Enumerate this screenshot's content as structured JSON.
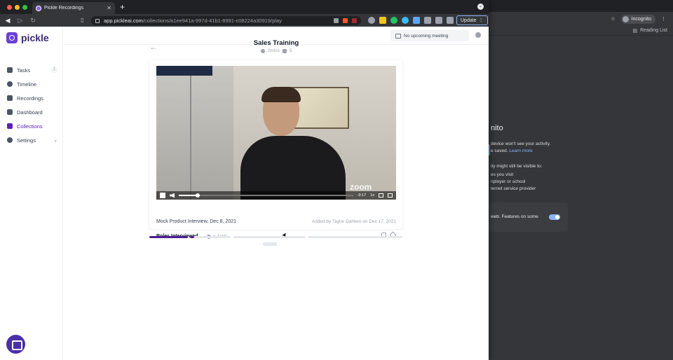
{
  "browser": {
    "tab_title": "Pickle Recordings",
    "tab_close": "✕",
    "new_tab": "+",
    "url_domain": "app.pickleai.com",
    "url_path": "/collections/a1ee941a-997d-41b1-8991-c08224a30919/play",
    "update_label": "Update"
  },
  "background_window": {
    "profile_label": "Incognito",
    "bookmarks_label": "Reading List",
    "incognito_title": "nito",
    "line1": "device won't see your activity.",
    "line2": "e saved.",
    "learn_more": "Learn more",
    "line3": "ity might still be visible to:",
    "item1": "es you visit",
    "item2": "nployer or school",
    "item3": "ternet service provider",
    "card_text": "web. Features on some"
  },
  "app": {
    "logo_text": "pickle",
    "sidebar": {
      "items": [
        {
          "label": "Tasks",
          "badge": "7",
          "icon": "check-square-icon"
        },
        {
          "label": "Timeline",
          "icon": "clock-icon"
        },
        {
          "label": "Recordings",
          "icon": "video-icon"
        },
        {
          "label": "Dashboard",
          "icon": "chart-icon"
        },
        {
          "label": "Collections",
          "icon": "collection-icon",
          "active": true
        },
        {
          "label": "Settings",
          "icon": "gear-icon",
          "chevron": "⌄"
        }
      ]
    },
    "topbar": {
      "meeting_label": "No upcoming meeting"
    },
    "page": {
      "back": "←",
      "title": "Sales Training",
      "duration": "2mins",
      "clip_count": "5"
    },
    "player": {
      "time_left": "-0:17",
      "speed": "1x",
      "progress": 0.11,
      "watermark": "zoom"
    },
    "clip": {
      "title": "Roles Interviewed",
      "duration": "< 1min",
      "recording_name": "Mock Product Interview, Dec 8, 2021",
      "added_by": "Added by Taylor Dahlem on Dec 17, 2021"
    },
    "segments": [
      {
        "progress": 1.0
      },
      {
        "progress": 0.1
      },
      {
        "progress": 0.0
      },
      {
        "progress": 0.0
      },
      {
        "progress": 0.0
      }
    ]
  },
  "colors": {
    "brand": "#5b21b6",
    "segment_fill": "#4c1d95"
  }
}
